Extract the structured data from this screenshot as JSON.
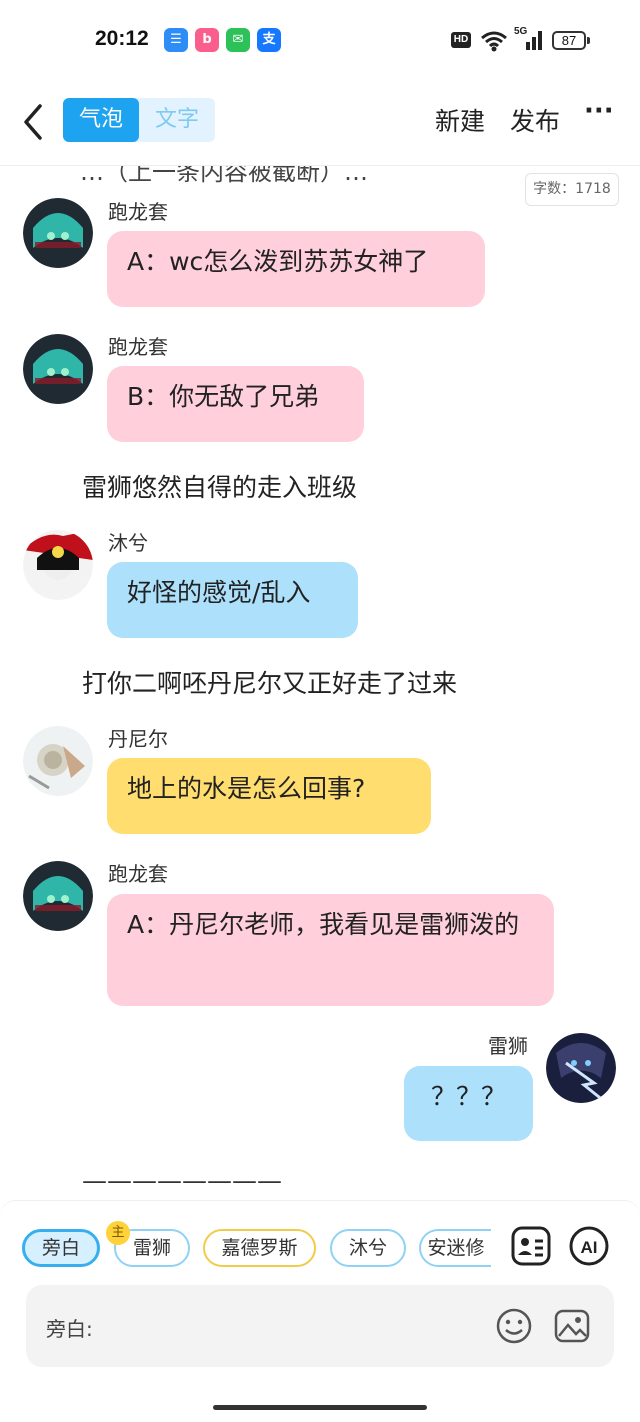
{
  "status_bar": {
    "time": "20:12",
    "apps": [
      {
        "icon": "message-app-icon",
        "color": "#2e8cf6",
        "glyph": "☰"
      },
      {
        "icon": "bilibili-icon",
        "color": "#fb5e8d",
        "glyph": "b"
      },
      {
        "icon": "wechat-icon",
        "color": "#2dc15a",
        "glyph": "✉"
      },
      {
        "icon": "alipay-icon",
        "color": "#1677ff",
        "glyph": "支"
      }
    ],
    "hd": "HD",
    "network": "5G",
    "battery": "87"
  },
  "header": {
    "mode_bubble": "气泡",
    "mode_text": "文字",
    "new_label": "新建",
    "publish_label": "发布",
    "more_label": "···"
  },
  "chat": {
    "cut_line": "…（上一条内容被截断）…",
    "word_count": "字数：1718",
    "messages": [
      {
        "sender": "跑龙套",
        "text": "A：wc怎么泼到苏苏女神了"
      },
      {
        "sender": "跑龙套",
        "text": "B：你无敌了兄弟"
      },
      {
        "narration": "雷狮悠然自得的走入班级"
      },
      {
        "sender": "沐兮",
        "text": "好怪的感觉/乱入"
      },
      {
        "narration": "打你二啊呸丹尼尔又正好走了过来"
      },
      {
        "sender": "丹尼尔",
        "text": "地上的水是怎么回事?"
      },
      {
        "sender": "跑龙套",
        "text": "A：丹尼尔老师，我看见是雷狮泼的"
      },
      {
        "sender": "雷狮",
        "text": "？？？"
      },
      {
        "narration": "————————"
      }
    ]
  },
  "characters": {
    "narrator": "旁白",
    "host_badge": "主",
    "items": [
      "雷狮",
      "嘉德罗斯",
      "沐兮",
      "安迷修"
    ]
  },
  "input": {
    "label": "旁白:"
  },
  "colors": {
    "accent": "#1ea3f0",
    "pink_bubble": "#ffd0dc",
    "blue_bubble": "#ade0fb",
    "yellow_bubble": "#ffdd6e"
  }
}
